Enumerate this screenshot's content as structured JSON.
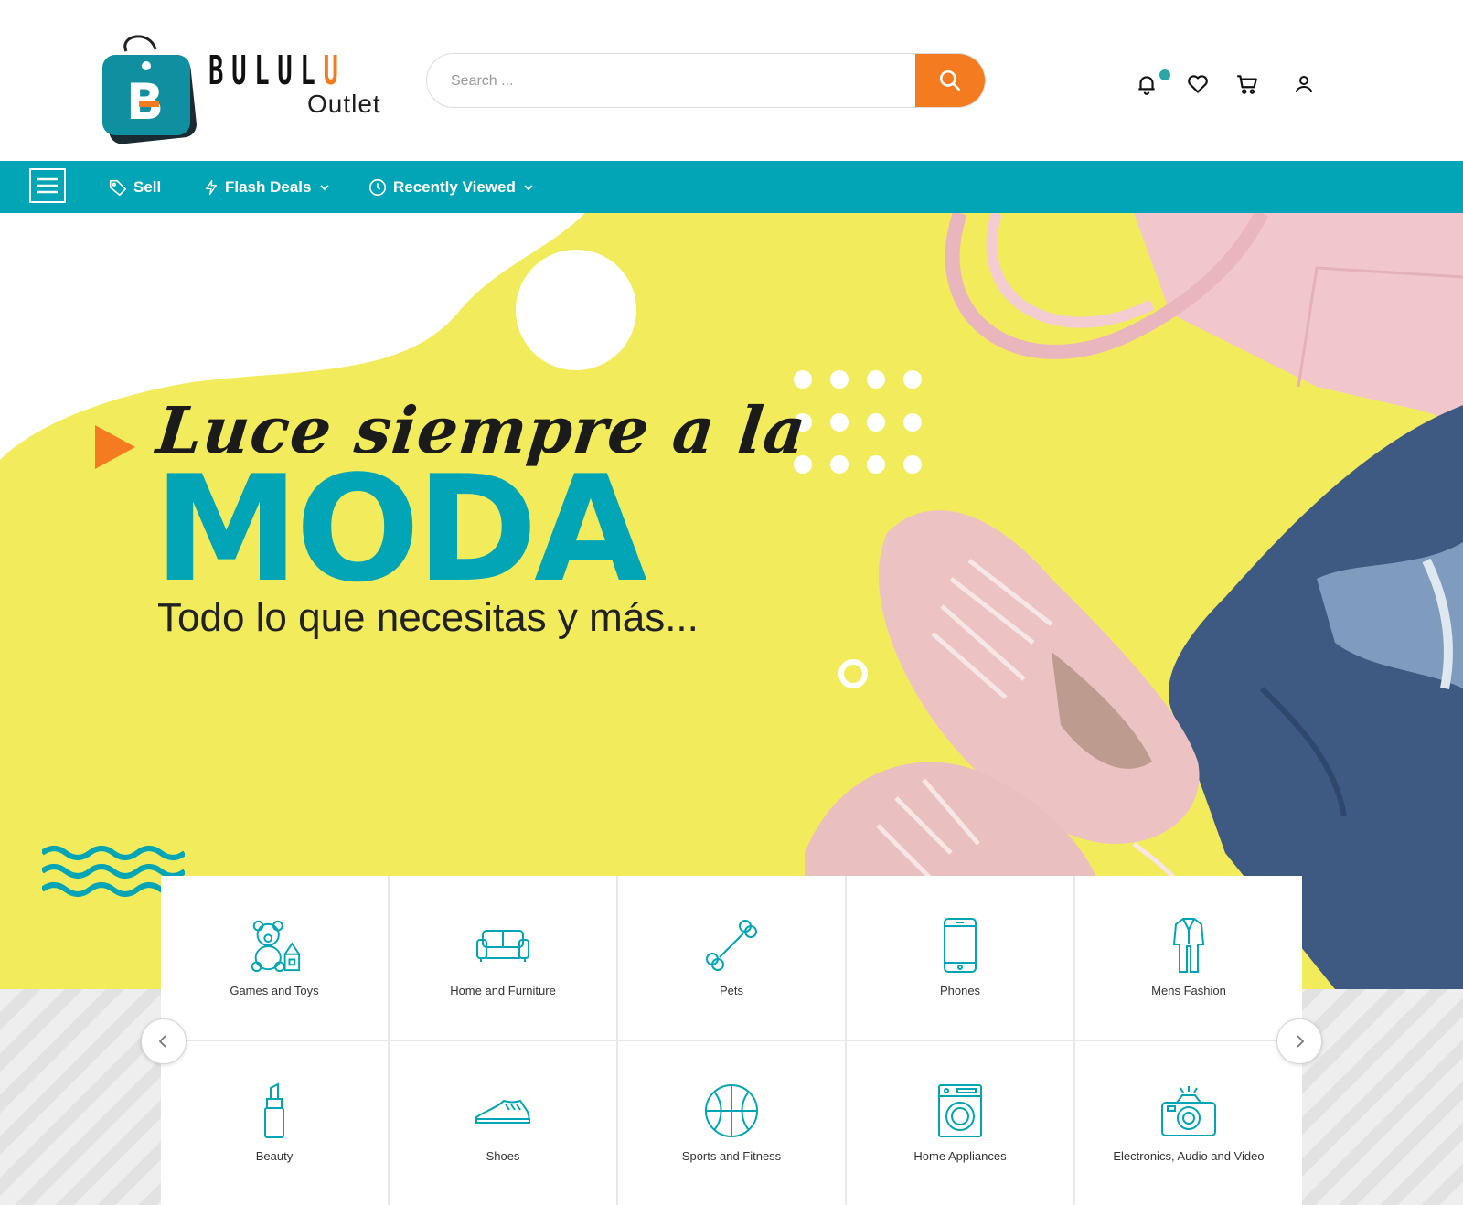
{
  "brand": {
    "word_part1": "BULUL",
    "word_part2": "U",
    "sub": "Outlet",
    "badge_letter": "B"
  },
  "search": {
    "placeholder": "Search ..."
  },
  "header_icons": [
    "bell-icon",
    "heart-icon",
    "cart-icon",
    "user-icon"
  ],
  "nav": {
    "items": [
      {
        "label": "Sell",
        "icon": "tag-icon"
      },
      {
        "label": "Flash Deals",
        "icon": "bolt-icon",
        "dropdown": true
      },
      {
        "label": "Recently Viewed",
        "icon": "clock-icon",
        "dropdown": true
      }
    ]
  },
  "hero": {
    "script_line": "Luce siempre a la",
    "title": "MODA",
    "subtitle": "Todo lo que necesitas y más..."
  },
  "categories": [
    {
      "label": "Games and Toys",
      "icon": "teddy-bear-icon"
    },
    {
      "label": "Home and Furniture",
      "icon": "sofa-icon"
    },
    {
      "label": "Pets",
      "icon": "bone-icon"
    },
    {
      "label": "Phones",
      "icon": "phone-icon"
    },
    {
      "label": "Mens Fashion",
      "icon": "suit-icon"
    },
    {
      "label": "Beauty",
      "icon": "lipstick-icon"
    },
    {
      "label": "Shoes",
      "icon": "sneaker-icon"
    },
    {
      "label": "Sports and Fitness",
      "icon": "ball-icon"
    },
    {
      "label": "Home Appliances",
      "icon": "washing-machine-icon"
    },
    {
      "label": "Electronics, Audio and Video",
      "icon": "camera-icon"
    }
  ],
  "colors": {
    "teal": "#01a5b5",
    "orange": "#f47b20",
    "hero_yellow": "#f2ec5d"
  }
}
